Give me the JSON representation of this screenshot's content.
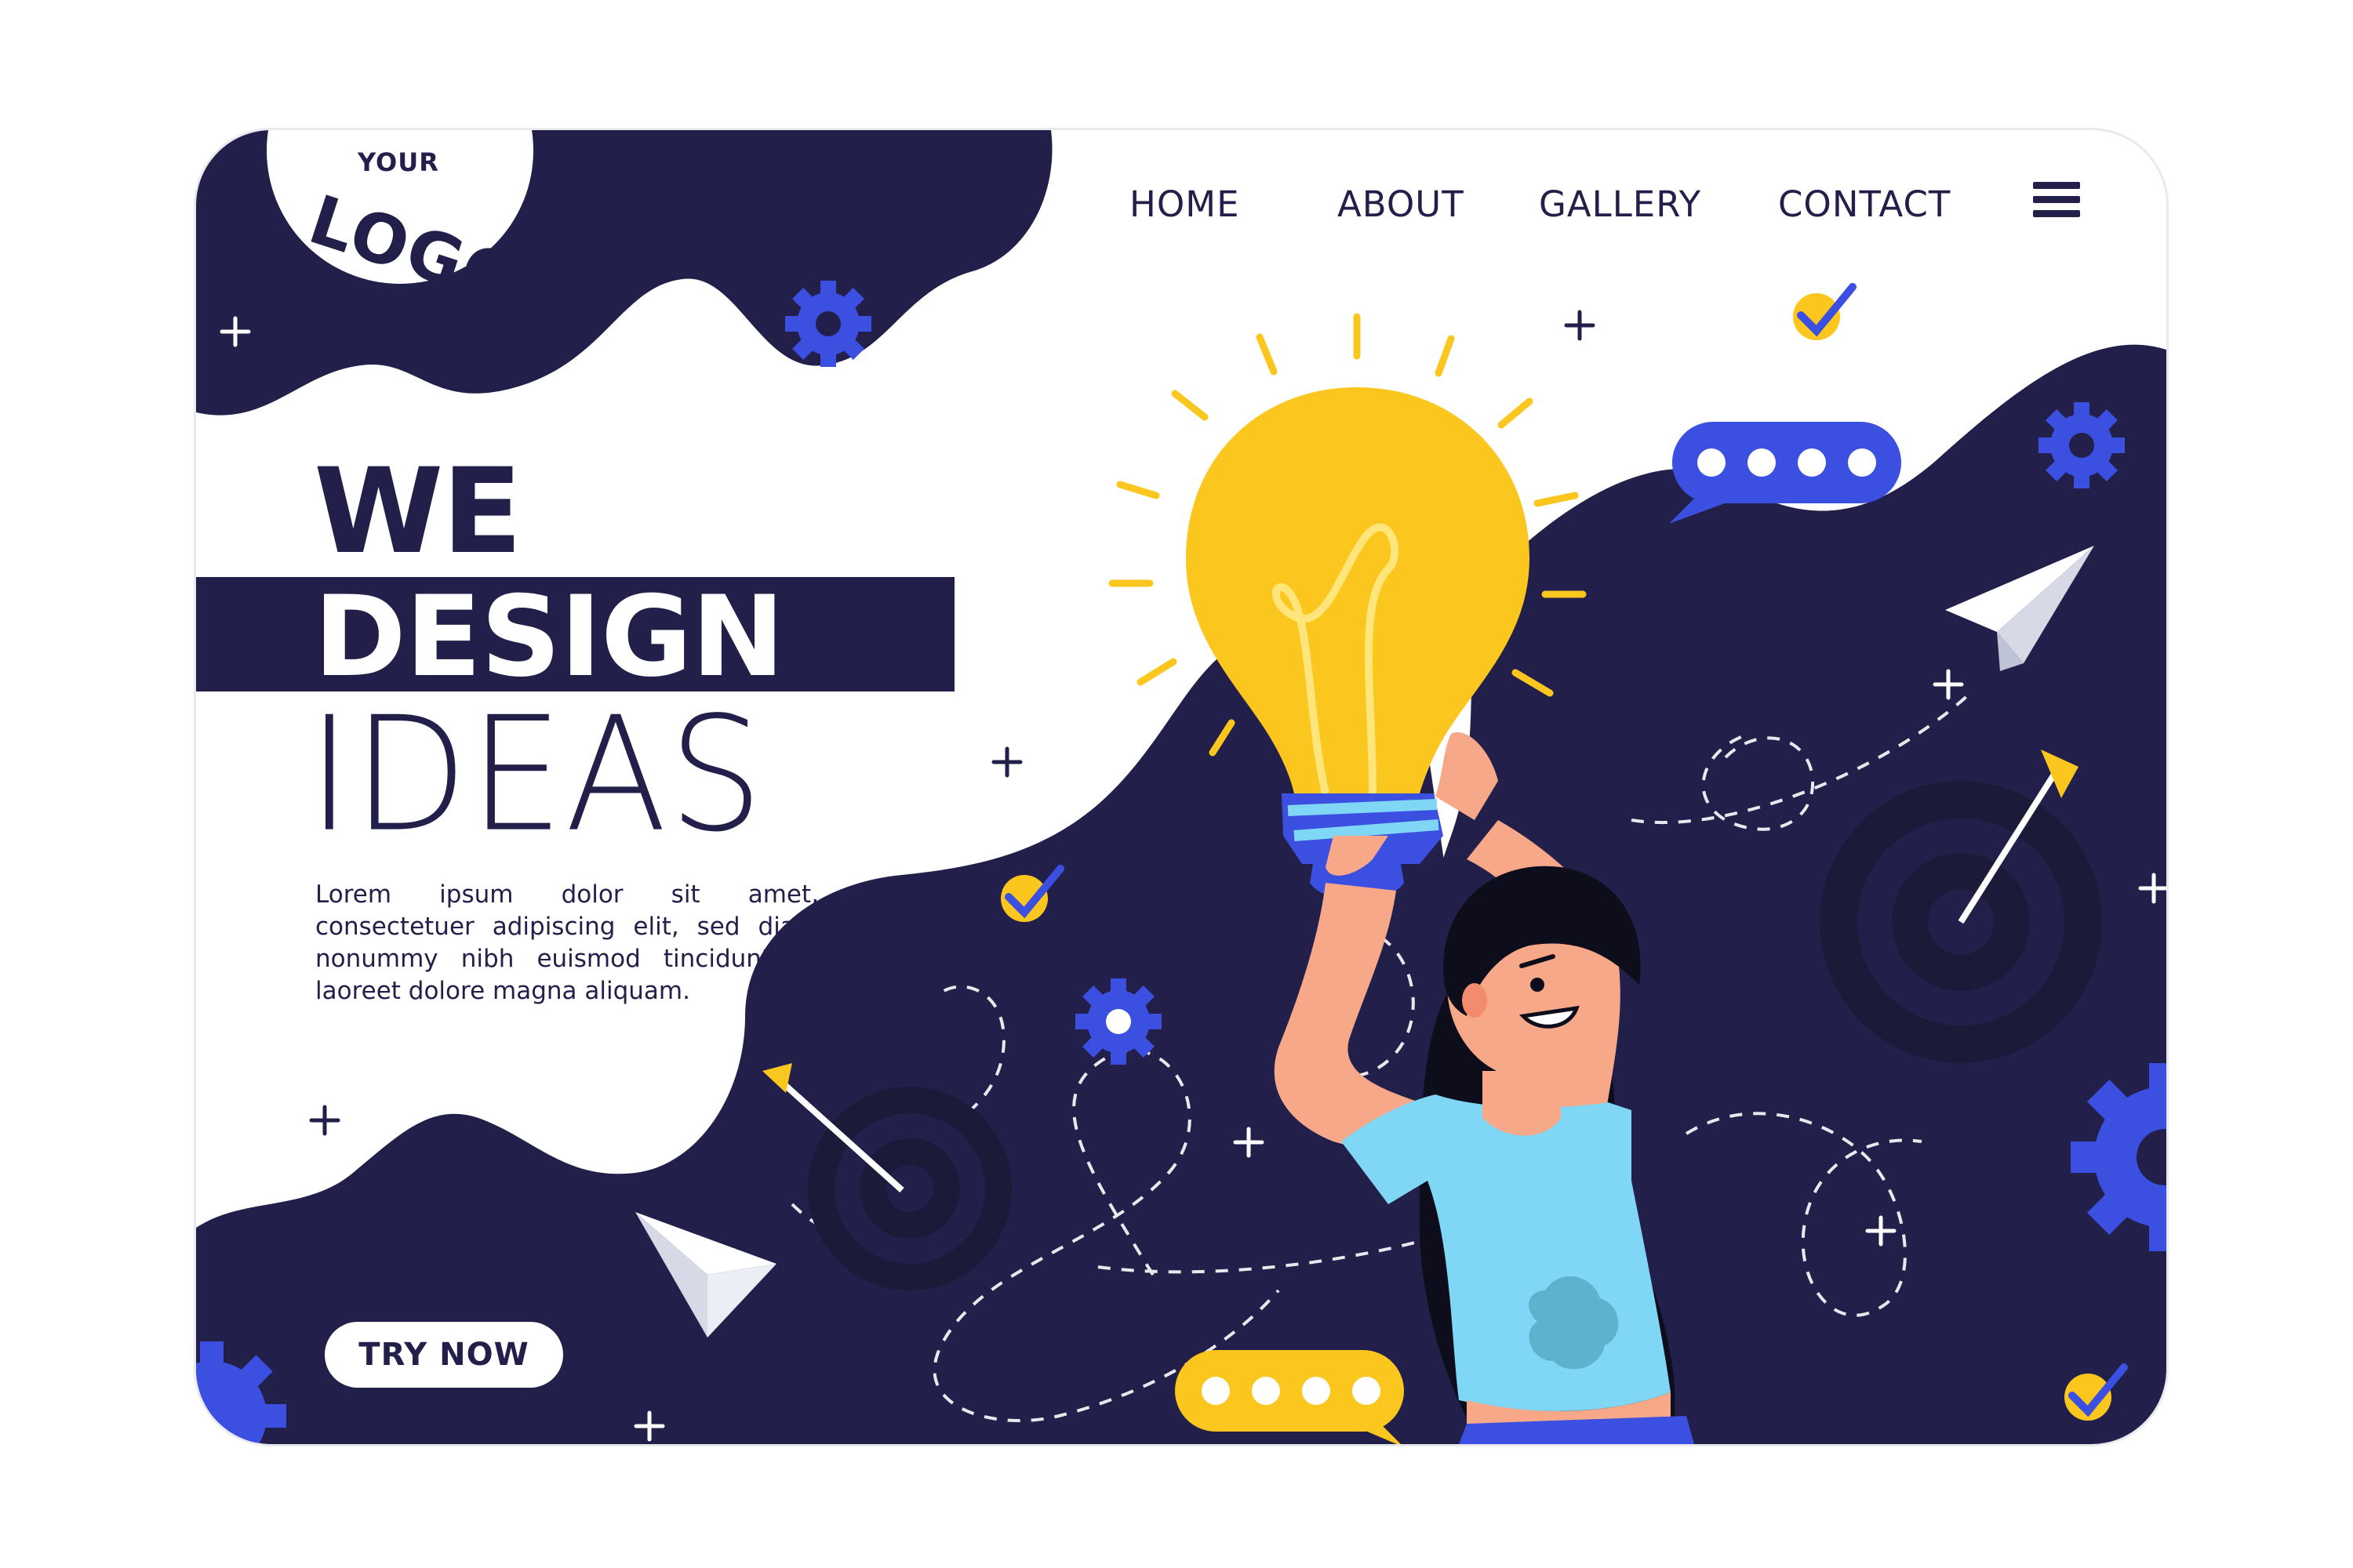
{
  "logo": {
    "line1": "YOUR",
    "line2": "LOGO"
  },
  "nav": {
    "items": [
      {
        "label": "HOME"
      },
      {
        "label": "ABOUT"
      },
      {
        "label": "GALLERY"
      },
      {
        "label": "CONTACT"
      }
    ],
    "menu_icon": "hamburger-menu-icon"
  },
  "hero": {
    "line1": "WE",
    "line2": "DESIGN",
    "line3": "IDEAS",
    "body": "Lorem ipsum dolor sit amet, consectetuer adipiscing elit, sed diam nonummy nibh euismod tincidunt ut laoreet dolore magna aliquam.",
    "cta_label": "TRY NOW"
  },
  "colors": {
    "navy": "#22204a",
    "blue": "#3b4fe0",
    "yellow": "#fbc61e",
    "light_blue": "#7fd6f5",
    "skin": "#f7a889",
    "white": "#ffffff"
  },
  "icons": [
    "gear-icon",
    "checkmark-badge-icon",
    "chat-bubble-icon",
    "paper-plane-icon",
    "target-icon",
    "arrow-icon",
    "plus-sparkle-icon",
    "lightbulb-icon"
  ]
}
